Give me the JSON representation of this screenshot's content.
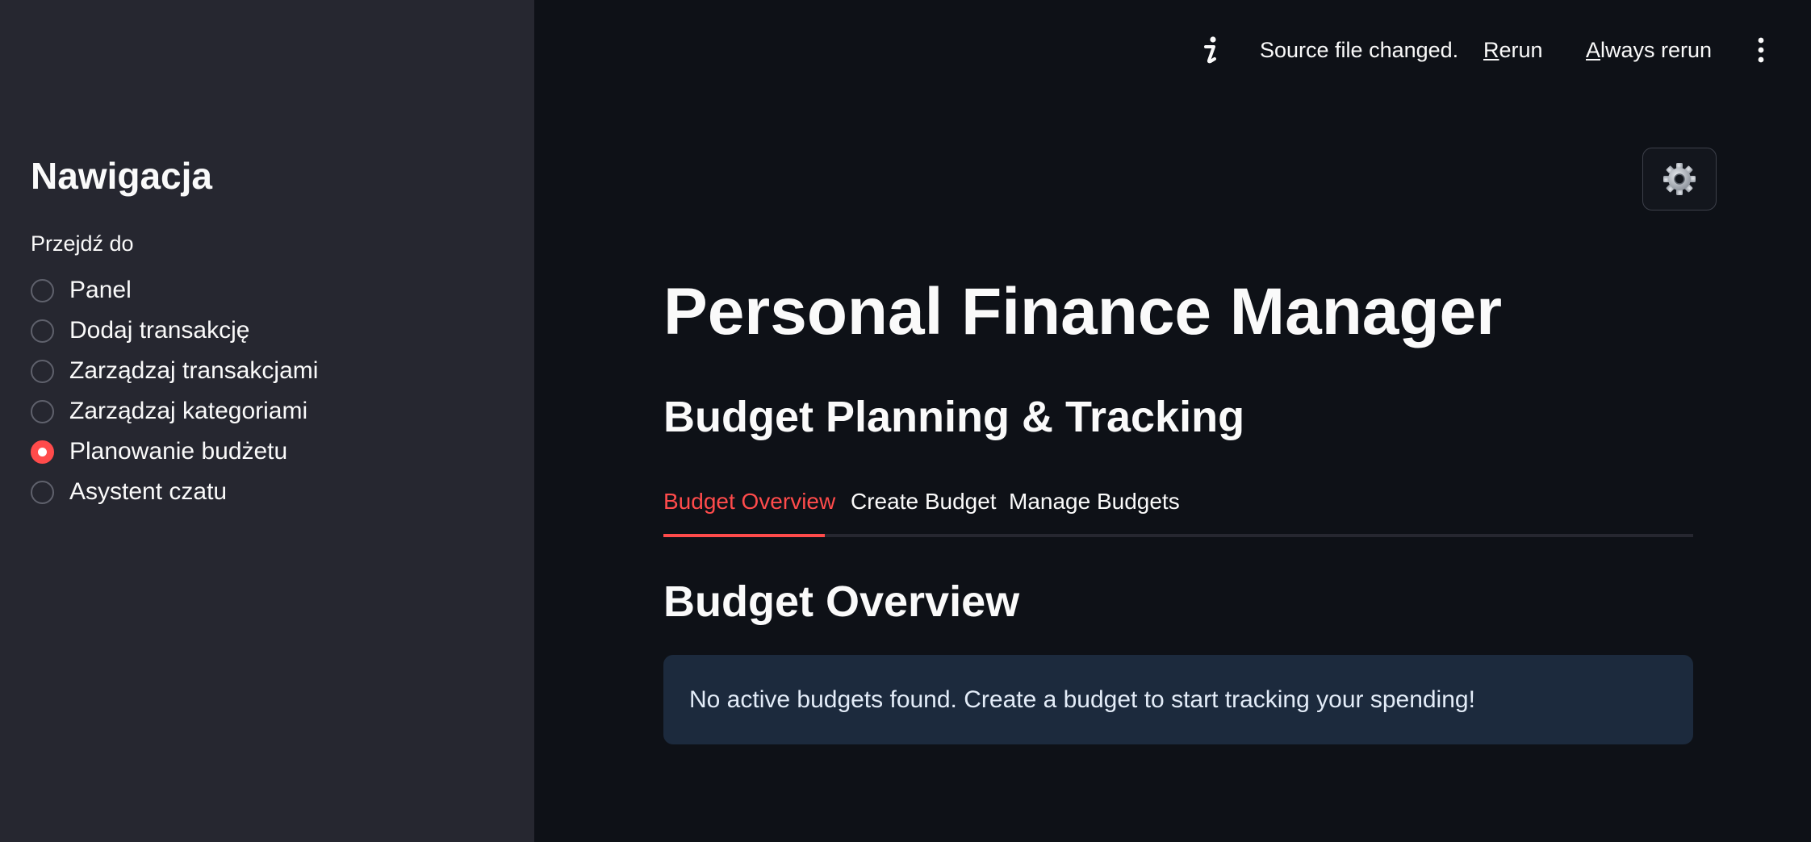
{
  "sidebar": {
    "title": "Nawigacja",
    "radio_label": "Przejdź do",
    "items": [
      {
        "label": "Panel",
        "selected": false
      },
      {
        "label": "Dodaj transakcję",
        "selected": false
      },
      {
        "label": "Zarządzaj transakcjami",
        "selected": false
      },
      {
        "label": "Zarządzaj kategoriami",
        "selected": false
      },
      {
        "label": "Planowanie budżetu",
        "selected": true
      },
      {
        "label": "Asystent czatu",
        "selected": false
      }
    ]
  },
  "header": {
    "status_text": "Source file changed.",
    "rerun": {
      "accel": "R",
      "rest": "erun"
    },
    "always_rerun": {
      "accel": "A",
      "rest": "lways rerun"
    },
    "info_icon": "info-icon",
    "menu_icon": "vertical-ellipsis-icon"
  },
  "settings": {
    "icon": "gear-icon"
  },
  "main": {
    "title": "Personal Finance Manager",
    "subtitle": "Budget Planning & Tracking",
    "tabs": [
      {
        "label": "Budget Overview",
        "active": true
      },
      {
        "label": "Create Budget",
        "active": false
      },
      {
        "label": "Manage Budgets",
        "active": false
      }
    ],
    "section_title": "Budget Overview",
    "info_message": "No active budgets found. Create a budget to start tracking your spending!"
  },
  "colors": {
    "background": "#0e1117",
    "sidebar": "#262730",
    "accent": "#ff4b4b",
    "info_box": "#1c2a3d",
    "text": "#fafafa"
  }
}
